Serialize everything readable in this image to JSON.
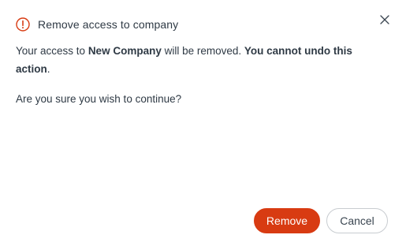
{
  "dialog": {
    "title": "Remove access to company",
    "message_prefix": "Your access to ",
    "company_name": "New Company",
    "message_middle": " will be removed. ",
    "warning": "You cannot undo this action",
    "message_suffix": ".",
    "confirm_question": "Are you sure you wish to continue?",
    "alert_icon": "alert-circle-icon",
    "close_icon": "close-icon"
  },
  "buttons": {
    "remove_label": "Remove",
    "cancel_label": "Cancel"
  },
  "colors": {
    "alert_accent": "#d83b12",
    "primary_button": "#d83b12",
    "text": "#2f3a45",
    "secondary_border": "#c8ccd0"
  }
}
